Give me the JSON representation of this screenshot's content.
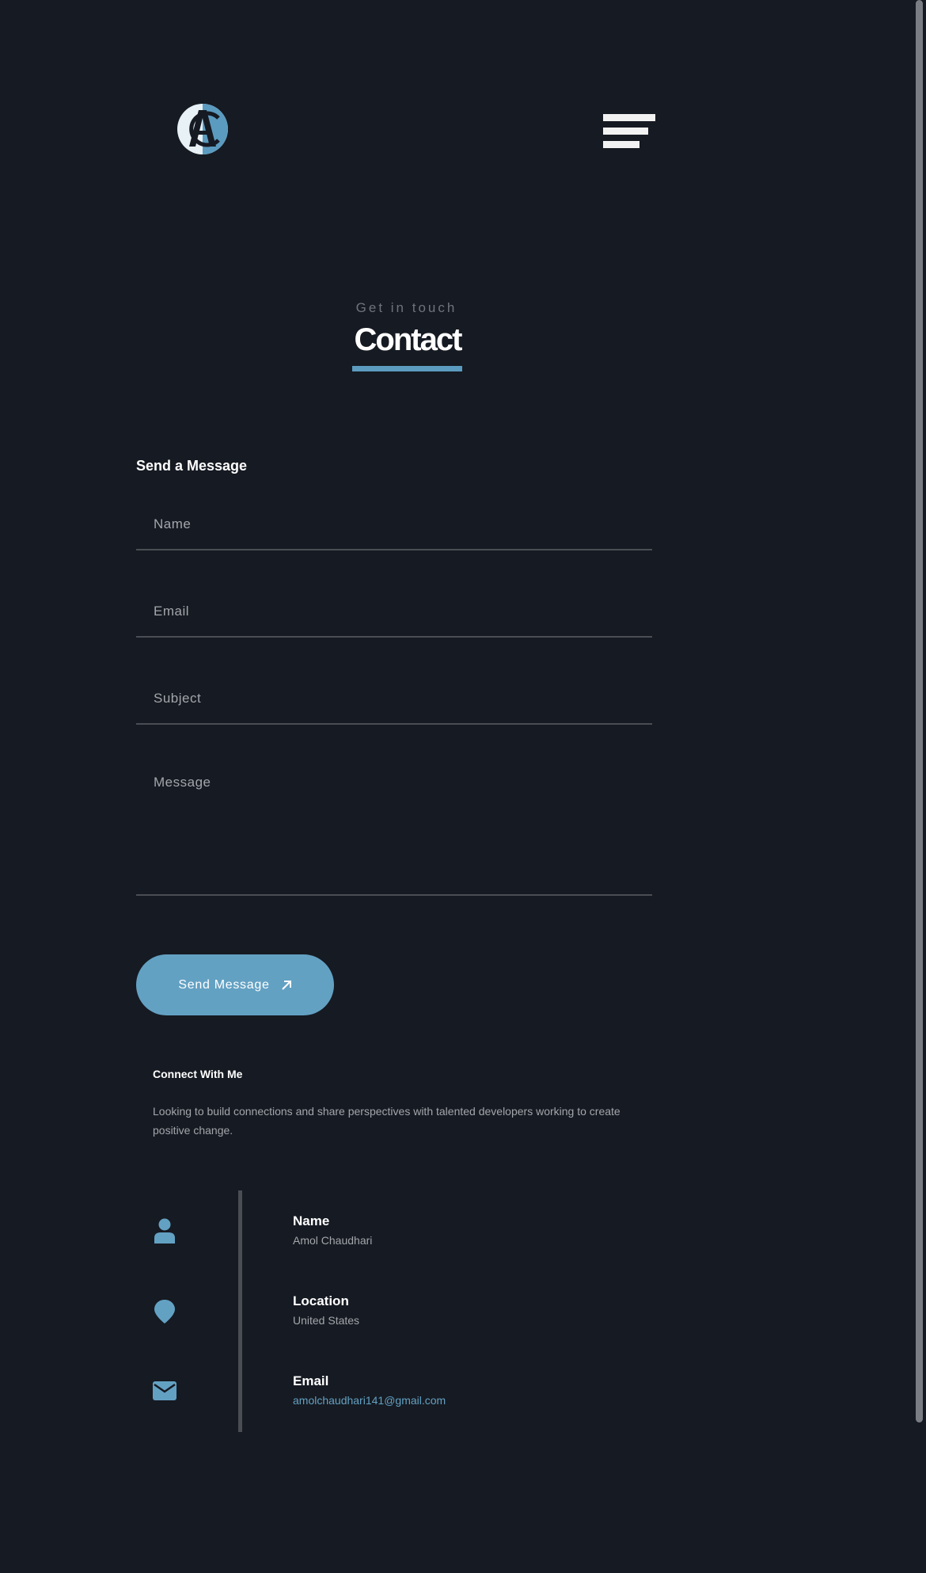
{
  "header": {
    "logo_alt": "AC",
    "menu_icon": "hamburger-menu-icon"
  },
  "section": {
    "eyebrow": "Get in touch",
    "title": "Contact"
  },
  "form": {
    "heading": "Send a Message",
    "name_placeholder": "Name",
    "email_placeholder": "Email",
    "subject_placeholder": "Subject",
    "message_placeholder": "Message",
    "submit_label": "Send Message",
    "submit_icon": "arrow-up-right-icon"
  },
  "connect": {
    "heading": "Connect With Me",
    "text": "Looking to build connections and share perspectives with talented developers working to create positive change."
  },
  "info": [
    {
      "icon": "user-icon",
      "label": "Name",
      "value": "Amol Chaudhari"
    },
    {
      "icon": "location-pin-icon",
      "label": "Location",
      "value": "United States"
    },
    {
      "icon": "envelope-icon",
      "label": "Email",
      "value": "amolchaudhari141@gmail.com"
    }
  ],
  "colors": {
    "background": "#161a22",
    "accent": "#63a1c3",
    "muted_text": "#a3a6ab",
    "divider": "#4a4d53"
  }
}
